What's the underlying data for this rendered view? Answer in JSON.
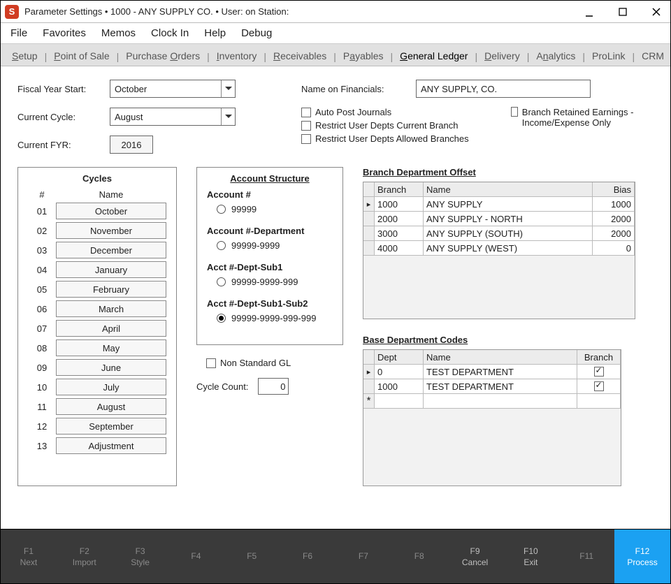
{
  "window": {
    "icon_letter": "S",
    "title": "Parameter Settings   •   1000 - ANY SUPPLY CO.   •   User:              on Station:"
  },
  "menu": [
    "File",
    "Favorites",
    "Memos",
    "Clock In",
    "Help",
    "Debug"
  ],
  "tabs": [
    {
      "label": "Setup",
      "ul": "S"
    },
    {
      "label": "Point of Sale",
      "ul": "P"
    },
    {
      "label": "Purchase Orders",
      "ul": "O"
    },
    {
      "label": "Inventory",
      "ul": "I"
    },
    {
      "label": "Receivables",
      "ul": "R"
    },
    {
      "label": "Payables",
      "ul": "a"
    },
    {
      "label": "General Ledger",
      "ul": "G",
      "active": true
    },
    {
      "label": "Delivery",
      "ul": "D"
    },
    {
      "label": "Analytics",
      "ul": "n"
    },
    {
      "label": "ProLink",
      "ul": ""
    },
    {
      "label": "CRM",
      "ul": ""
    }
  ],
  "form": {
    "fiscal_year_start_label": "Fiscal Year Start:",
    "fiscal_year_start_value": "October",
    "current_cycle_label": "Current Cycle:",
    "current_cycle_value": "August",
    "current_fyr_label": "Current FYR:",
    "current_fyr_value": "2016",
    "name_financials_label": "Name on Financials:",
    "name_financials_value": "ANY SUPPLY, CO.",
    "auto_post": "Auto Post Journals",
    "restrict_current": "Restrict User Depts Current Branch",
    "restrict_allowed": "Restrict User Depts Allowed Branches",
    "branch_retained": "Branch Retained Earnings - Income/Expense Only"
  },
  "cycles": {
    "title": "Cycles",
    "head_num": "#",
    "head_name": "Name",
    "rows": [
      {
        "n": "01",
        "name": "October"
      },
      {
        "n": "02",
        "name": "November"
      },
      {
        "n": "03",
        "name": "December"
      },
      {
        "n": "04",
        "name": "January"
      },
      {
        "n": "05",
        "name": "February"
      },
      {
        "n": "06",
        "name": "March"
      },
      {
        "n": "07",
        "name": "April"
      },
      {
        "n": "08",
        "name": "May"
      },
      {
        "n": "09",
        "name": "June"
      },
      {
        "n": "10",
        "name": "July"
      },
      {
        "n": "11",
        "name": "August"
      },
      {
        "n": "12",
        "name": "September"
      },
      {
        "n": "13",
        "name": "Adjustment"
      }
    ]
  },
  "acct": {
    "title": "Account Structure",
    "groups": [
      {
        "label": "Account #",
        "value": "99999",
        "selected": false
      },
      {
        "label": "Account #-Department",
        "value": "99999-9999",
        "selected": false
      },
      {
        "label": "Acct #-Dept-Sub1",
        "value": "99999-9999-999",
        "selected": false
      },
      {
        "label": "Acct #-Dept-Sub1-Sub2",
        "value": "99999-9999-999-999",
        "selected": true
      }
    ],
    "non_standard": "Non Standard GL",
    "cycle_count_label": "Cycle Count:",
    "cycle_count_value": "0"
  },
  "branch_offset": {
    "title": "Branch Department Offset",
    "head": [
      "Branch",
      "Name",
      "Bias"
    ],
    "rows": [
      {
        "branch": "1000",
        "name": "ANY SUPPLY",
        "bias": "1000",
        "sel": true
      },
      {
        "branch": "2000",
        "name": "ANY SUPPLY - NORTH",
        "bias": "2000"
      },
      {
        "branch": "3000",
        "name": "ANY SUPPLY (SOUTH)",
        "bias": "2000"
      },
      {
        "branch": "4000",
        "name": "ANY SUPPLY (WEST)",
        "bias": "0"
      }
    ]
  },
  "base_dept": {
    "title": "Base Department Codes",
    "head": [
      "Dept",
      "Name",
      "Branch"
    ],
    "rows": [
      {
        "dept": "0",
        "name": "TEST DEPARTMENT",
        "branch": true,
        "sel": true
      },
      {
        "dept": "1000",
        "name": "TEST DEPARTMENT",
        "branch": true
      }
    ]
  },
  "fkeys": [
    {
      "k": "F1",
      "l": "Next",
      "dim": true
    },
    {
      "k": "F2",
      "l": "Import",
      "dim": true
    },
    {
      "k": "F3",
      "l": "Style",
      "dim": true
    },
    {
      "k": "F4",
      "l": "",
      "dim": true
    },
    {
      "k": "F5",
      "l": "",
      "dim": true
    },
    {
      "k": "F6",
      "l": "",
      "dim": true
    },
    {
      "k": "F7",
      "l": "",
      "dim": true
    },
    {
      "k": "F8",
      "l": "",
      "dim": true
    },
    {
      "k": "F9",
      "l": "Cancel"
    },
    {
      "k": "F10",
      "l": "Exit"
    },
    {
      "k": "F11",
      "l": "",
      "dim": true
    },
    {
      "k": "F12",
      "l": "Process",
      "process": true
    }
  ]
}
